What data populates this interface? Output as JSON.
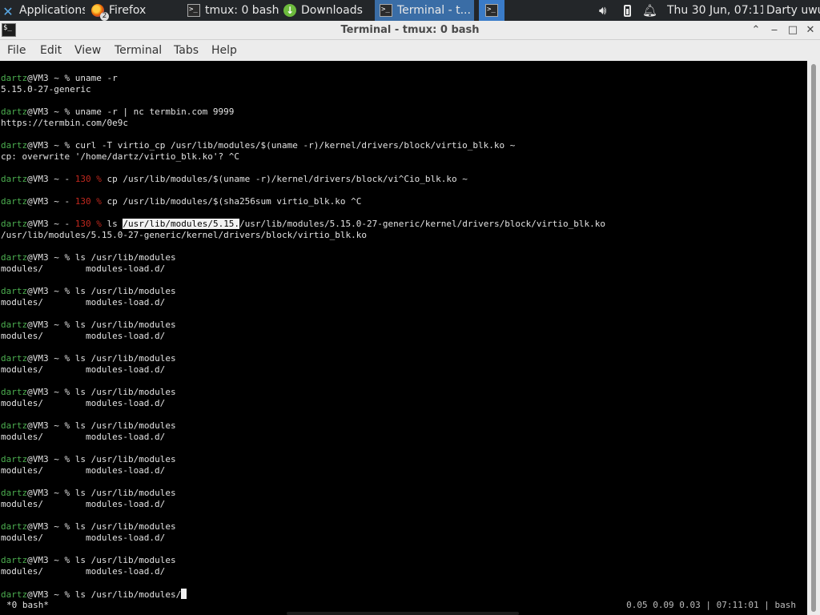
{
  "panel": {
    "applications": "Applications",
    "tasks": [
      {
        "label": "Firefox",
        "badge": "2"
      },
      {
        "label": "tmux: 0 bash"
      },
      {
        "label": "Downloads"
      },
      {
        "label": "Terminal - t..."
      }
    ],
    "clock": "Thu 30 Jun, 07:11",
    "user": "Darty uwu"
  },
  "window": {
    "title": "Terminal - tmux: 0 bash",
    "menu": [
      "File",
      "Edit",
      "View",
      "Terminal",
      "Tabs",
      "Help"
    ]
  },
  "terminal": {
    "user": "dartz",
    "host_path": "@VM3 ~ ",
    "lines": [
      {
        "cmd": "uname -r"
      },
      {
        "out": "5.15.0-27-generic"
      },
      {
        "cmd": "uname -r | nc termbin.com 9999"
      },
      {
        "out": "https://termbin.com/0e9c"
      },
      {
        "cmd": "curl -T virtio_cp /usr/lib/modules/$(uname -r)/kernel/drivers/block/virtio_blk.ko ~"
      },
      {
        "out": "cp: overwrite '/home/dartz/virtio_blk.ko'? ^C"
      },
      {
        "err": "130",
        "cmd": "cp /usr/lib/modules/$(uname -r)/kernel/drivers/block/vi^Cio_blk.ko ~"
      },
      {
        "err": "130",
        "cmd": "cp /usr/lib/modules/$(sha256sum virtio_blk.ko ^C"
      },
      {
        "err": "130",
        "cmd_pre": "ls ",
        "cmd_sel": "/usr/lib/modules/5.15.",
        "cmd_post": "/usr/lib/modules/5.15.0-27-generic/kernel/drivers/block/virtio_blk.ko"
      },
      {
        "out": "/usr/lib/modules/5.15.0-27-generic/kernel/drivers/block/virtio_blk.ko"
      },
      {
        "cmd": "ls /usr/lib/modules"
      },
      {
        "out": "modules/        modules-load.d/"
      },
      {
        "cmd": "ls /usr/lib/modules"
      },
      {
        "out": "modules/        modules-load.d/"
      },
      {
        "cmd": "ls /usr/lib/modules"
      },
      {
        "out": "modules/        modules-load.d/"
      },
      {
        "cmd": "ls /usr/lib/modules"
      },
      {
        "out": "modules/        modules-load.d/"
      },
      {
        "cmd": "ls /usr/lib/modules"
      },
      {
        "out": "modules/        modules-load.d/"
      },
      {
        "cmd": "ls /usr/lib/modules"
      },
      {
        "out": "modules/        modules-load.d/"
      },
      {
        "cmd": "ls /usr/lib/modules"
      },
      {
        "out": "modules/        modules-load.d/"
      },
      {
        "cmd": "ls /usr/lib/modules"
      },
      {
        "out": "modules/        modules-load.d/"
      },
      {
        "cmd": "ls /usr/lib/modules"
      },
      {
        "out": "modules/        modules-load.d/"
      },
      {
        "cmd": "ls /usr/lib/modules"
      },
      {
        "out": "modules/        modules-load.d/"
      },
      {
        "cmd": "ls /usr/lib/modules/",
        "current": true
      }
    ],
    "status_left": "*0 bash*",
    "status_right": "0.05 0.09 0.03 | 07:11:01 | bash"
  },
  "colors": {
    "panel_bg": "#232629",
    "active_task": "#3a6da6",
    "prompt_user": "#4caf50",
    "exit_code": "#c0281e",
    "terminal_bg": "#000000"
  }
}
